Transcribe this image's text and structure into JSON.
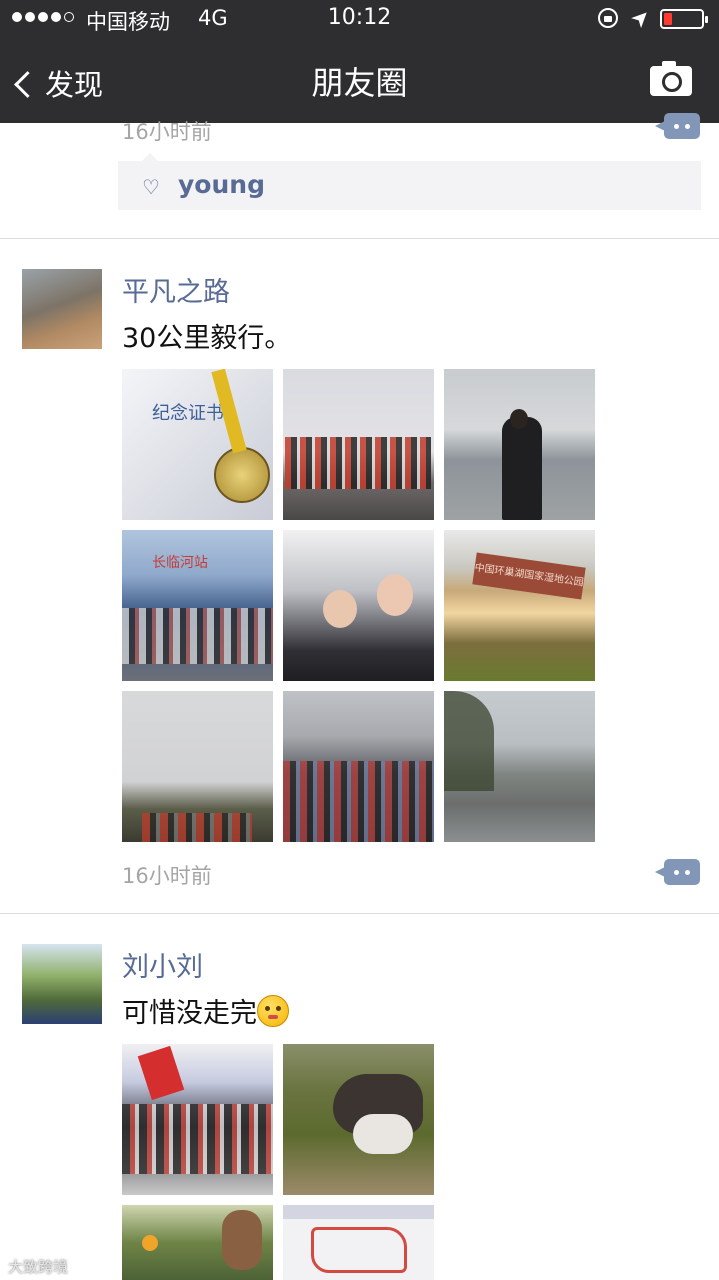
{
  "status_bar": {
    "carrier": "中国移动",
    "network": "4G",
    "time": "10:12"
  },
  "nav": {
    "back_label": "发现",
    "title": "朋友圈"
  },
  "prev_post": {
    "time": "16小时前",
    "like_name": "young"
  },
  "post1": {
    "author": "平凡之路",
    "text": "30公里毅行。",
    "time": "16小时前",
    "photos": [
      {
        "name": "photo-certificate-medal",
        "overlay": "纪念证书"
      },
      {
        "name": "photo-group-on-shore",
        "overlay": ""
      },
      {
        "name": "photo-man-by-water",
        "overlay": ""
      },
      {
        "name": "photo-group-banner",
        "overlay": "长临河站"
      },
      {
        "name": "photo-selfie-bus",
        "overlay": ""
      },
      {
        "name": "photo-park-sign",
        "overlay": "中国环巢湖国家湿地公园"
      },
      {
        "name": "photo-misty-crowd",
        "overlay": ""
      },
      {
        "name": "photo-crowd-street",
        "overlay": ""
      },
      {
        "name": "photo-lakeside-road",
        "overlay": ""
      }
    ]
  },
  "post2": {
    "author": "刘小刘",
    "text": "可惜没走完",
    "photos": [
      {
        "name": "photo-event-crowd",
        "overlay": ""
      },
      {
        "name": "photo-husky-dog",
        "overlay": ""
      },
      {
        "name": "photo-flowers-dog",
        "overlay": ""
      },
      {
        "name": "photo-route-map",
        "overlay": ""
      }
    ]
  },
  "watermark": "大致跨境",
  "colors": {
    "bar": "#2e2e31",
    "link": "#576b95",
    "meta": "#a5a5a5",
    "comment_btn": "#8296b8"
  }
}
